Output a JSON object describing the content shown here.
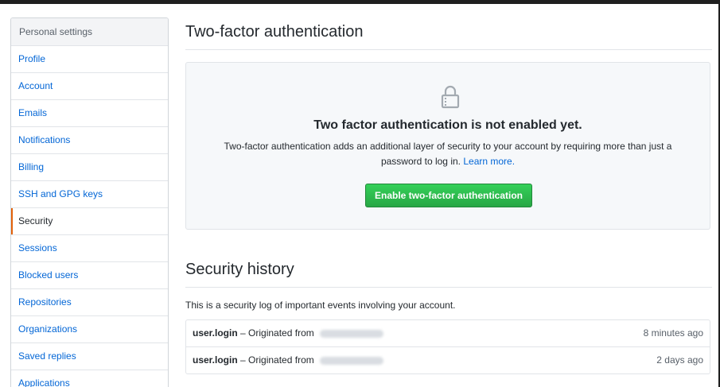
{
  "sidebar": {
    "header": "Personal settings",
    "items": [
      {
        "label": "Profile"
      },
      {
        "label": "Account"
      },
      {
        "label": "Emails"
      },
      {
        "label": "Notifications"
      },
      {
        "label": "Billing"
      },
      {
        "label": "SSH and GPG keys"
      },
      {
        "label": "Security",
        "selected": true
      },
      {
        "label": "Sessions"
      },
      {
        "label": "Blocked users"
      },
      {
        "label": "Repositories"
      },
      {
        "label": "Organizations"
      },
      {
        "label": "Saved replies"
      },
      {
        "label": "Applications"
      }
    ]
  },
  "two_factor": {
    "title": "Two-factor authentication",
    "icon": "lock-icon",
    "heading": "Two factor authentication is not enabled yet.",
    "description": "Two-factor authentication adds an additional layer of security to your account by requiring more than just a password to log in.",
    "learn_more": "Learn more.",
    "enable_button": "Enable two-factor authentication"
  },
  "security_history": {
    "title": "Security history",
    "description": "This is a security log of important events involving your account.",
    "entries": [
      {
        "event": "user.login",
        "origin_text": "– Originated from",
        "time": "8 minutes ago"
      },
      {
        "event": "user.login",
        "origin_text": "– Originated from",
        "time": "2 days ago"
      }
    ]
  },
  "colors": {
    "link": "#0366d6",
    "selected_marker": "#e36209",
    "button_green": "#28a745"
  }
}
